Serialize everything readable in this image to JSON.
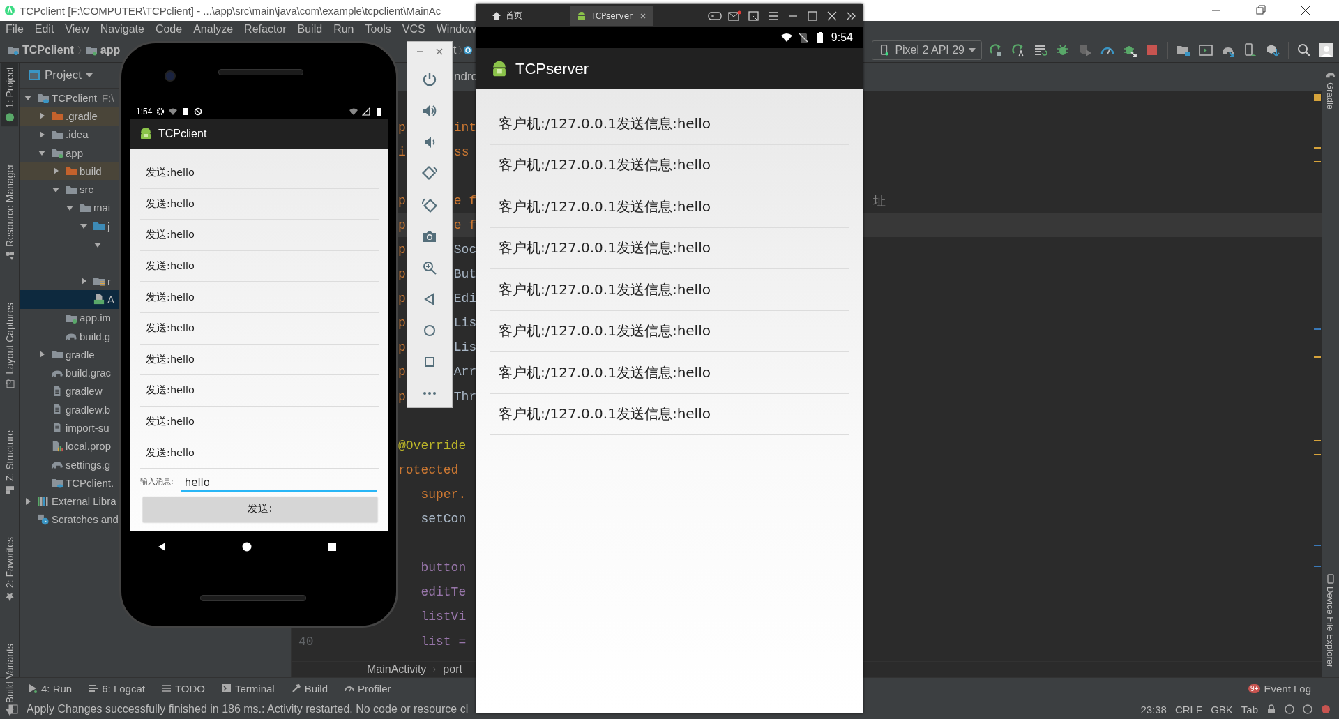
{
  "ide": {
    "title": "TCPclient [F:\\COMPUTER\\TCPclient] - ...\\app\\src\\main\\java\\com\\example\\tcpclient\\MainAc",
    "menu": [
      "File",
      "Edit",
      "View",
      "Navigate",
      "Code",
      "Analyze",
      "Refactor",
      "Build",
      "Run",
      "Tools",
      "VCS",
      "Window"
    ],
    "breadcrumb": [
      "TCPclient",
      "app"
    ],
    "nav_fragment": "t",
    "editor_tab_fragment": "ndro",
    "device": "Pixel 2 API 29",
    "left_tools": [
      {
        "label": "1: Project",
        "kind": "project",
        "selected": true
      },
      {
        "label": "Resource Manager",
        "kind": "resources",
        "selected": false
      },
      {
        "label": "Layout Captures",
        "kind": "captures",
        "selected": false
      },
      {
        "label": "Z: Structure",
        "kind": "structure",
        "selected": false
      },
      {
        "label": "2: Favorites",
        "kind": "favorites",
        "selected": false
      },
      {
        "label": "Build Variants",
        "kind": "variants",
        "selected": false
      }
    ],
    "right_tools": [
      {
        "label": "Gradle",
        "kind": "gradle"
      },
      {
        "label": "Device File Explorer",
        "kind": "device"
      }
    ],
    "project": {
      "title": "Project",
      "tree": [
        {
          "label": "TCPclient",
          "note": "F:\\",
          "kind": "project",
          "expanded": true,
          "selected": false,
          "children": [
            {
              "label": ".gradle",
              "kind": "excluded",
              "expanded": false,
              "selected": false
            },
            {
              "label": ".idea",
              "kind": "folder",
              "expanded": false,
              "selected": false
            },
            {
              "label": "app",
              "kind": "module",
              "expanded": true,
              "selected": false,
              "children": [
                {
                  "label": "build",
                  "kind": "excluded",
                  "expanded": false,
                  "selected": false
                },
                {
                  "label": "src",
                  "kind": "folder",
                  "expanded": true,
                  "selected": false,
                  "children": [
                    {
                      "label": "mai",
                      "kind": "folder",
                      "expanded": true,
                      "selected": false,
                      "children": [
                        {
                          "label": "j",
                          "kind": "source",
                          "expanded": true,
                          "selected": false,
                          "children": [
                            {
                              "expanded": true,
                              "selected": false,
                              "children": [
                                {
                                  "selected": false
                                }
                              ]
                            }
                          ]
                        },
                        {
                          "label": "r",
                          "kind": "res",
                          "expanded": false,
                          "selected": false
                        },
                        {
                          "label": "A",
                          "kind": "manifest",
                          "selected": true
                        }
                      ]
                    }
                  ]
                },
                {
                  "label": "app.im",
                  "kind": "iml",
                  "selected": false
                },
                {
                  "label": "build.g",
                  "kind": "gradle",
                  "selected": false
                }
              ]
            },
            {
              "label": "gradle",
              "kind": "folder",
              "expanded": false,
              "selected": false
            },
            {
              "label": "build.grac",
              "kind": "gradle",
              "selected": false
            },
            {
              "label": "gradlew",
              "kind": "file",
              "selected": false
            },
            {
              "label": "gradlew.b",
              "kind": "file",
              "selected": false
            },
            {
              "label": "import-su",
              "kind": "file",
              "selected": false
            },
            {
              "label": "local.prop",
              "kind": "properties",
              "selected": false
            },
            {
              "label": "settings.g",
              "kind": "gradle",
              "selected": false
            },
            {
              "label": "TCPclient.",
              "kind": "project-file",
              "selected": false
            }
          ]
        },
        {
          "label": "External Libra",
          "kind": "libraries",
          "expanded": false,
          "selected": false
        },
        {
          "label": "Scratches and",
          "kind": "scratches",
          "selected": false
        }
      ]
    },
    "code_lines": [
      {
        "left": "p",
        "text": "int",
        "kind": "keyword",
        "current": false
      },
      {
        "left": "i",
        "text": "ss",
        "kind": "keyword",
        "current": false
      },
      {
        "current": false
      },
      {
        "left": "p",
        "text": "e f",
        "kind": "keyword",
        "tail": "址",
        "current": false
      },
      {
        "left": "p",
        "text": "e f",
        "kind": "keyword",
        "current": true
      },
      {
        "left": "p",
        "text": "Soc",
        "kind": "plain",
        "current": false
      },
      {
        "left": "p",
        "text": "But",
        "kind": "plain",
        "current": false
      },
      {
        "left": "p",
        "text": "Edi",
        "kind": "plain",
        "current": false
      },
      {
        "left": "p",
        "text": "Lis",
        "kind": "plain",
        "current": false
      },
      {
        "left": "p",
        "text": "Lis",
        "kind": "plain",
        "current": false
      },
      {
        "left": "p",
        "text": "Arr",
        "kind": "plain",
        "current": false
      },
      {
        "left": "p",
        "text": "Thr",
        "kind": "plain",
        "current": false
      },
      {
        "current": false
      },
      {
        "text": "@Override",
        "kind": "annotation",
        "current": false
      },
      {
        "text": "rotected",
        "kind": "keyword",
        "current": false
      },
      {
        "text": "   super.",
        "kind": "keyword",
        "current": false
      },
      {
        "text": "   setCon",
        "kind": "plain",
        "current": false
      },
      {
        "current": false
      },
      {
        "text": "   button",
        "kind": "field",
        "current": false
      },
      {
        "text": "   editTe",
        "kind": "field",
        "current": false
      },
      {
        "text": "   listVi",
        "kind": "field",
        "current": false
      },
      {
        "text": "   list =",
        "kind": "field",
        "line_number": "40",
        "current": false
      }
    ],
    "editor_breadcrumb": [
      "MainActivity",
      "port"
    ],
    "tool_tabs": [
      {
        "label": "4: Run",
        "kind": "run"
      },
      {
        "label": "6: Logcat",
        "kind": "logcat"
      },
      {
        "label": "TODO",
        "kind": "todo"
      },
      {
        "label": "Terminal",
        "kind": "terminal"
      },
      {
        "label": "Build",
        "kind": "build"
      },
      {
        "label": "Profiler",
        "kind": "profiler"
      }
    ],
    "event_log": {
      "label": "Event Log",
      "badge": "9+"
    },
    "status": {
      "message": "Apply Changes successfully finished in 186 ms.: Activity restarted. No code or resource cl",
      "position": "23:38",
      "line_separator": "CRLF",
      "encoding": "GBK",
      "indent": "Tab"
    }
  },
  "phone": {
    "status_time": "1:54",
    "title": "TCPclient",
    "messages": [
      "发送:hello",
      "发送:hello",
      "发送:hello",
      "发送:hello",
      "发送:hello",
      "发送:hello",
      "发送:hello",
      "发送:hello",
      "发送:hello",
      "发送:hello"
    ],
    "input_label": "输入消息:",
    "input_value": "hello",
    "send_button": "发送:"
  },
  "server": {
    "tabs": [
      {
        "label": "首页",
        "kind": "home",
        "selected": false
      },
      {
        "label": "TCPserver",
        "kind": "app",
        "selected": true
      }
    ],
    "status_time": "9:54",
    "title": "TCPserver",
    "messages": [
      "客户机:/127.0.0.1发送信息:hello",
      "客户机:/127.0.0.1发送信息:hello",
      "客户机:/127.0.0.1发送信息:hello",
      "客户机:/127.0.0.1发送信息:hello",
      "客户机:/127.0.0.1发送信息:hello",
      "客户机:/127.0.0.1发送信息:hello",
      "客户机:/127.0.0.1发送信息:hello",
      "客户机:/127.0.0.1发送信息:hello"
    ]
  }
}
